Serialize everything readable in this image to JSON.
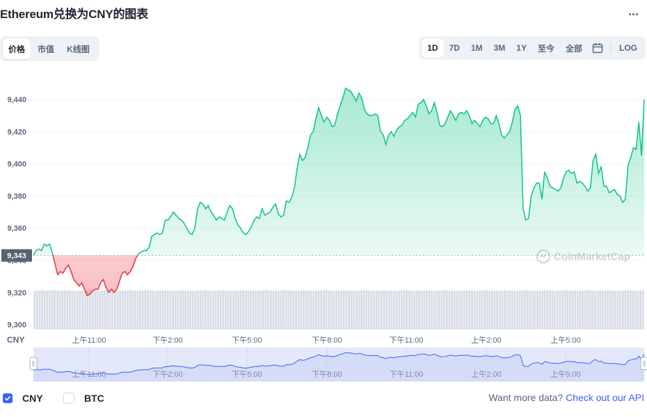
{
  "header": {
    "title": "Ethereum兑换为CNY的图表",
    "more_label": "..."
  },
  "tabs": [
    {
      "label": "价格",
      "active": true
    },
    {
      "label": "市值",
      "active": false
    },
    {
      "label": "K线图",
      "active": false
    }
  ],
  "ranges": [
    {
      "label": "1D",
      "active": true
    },
    {
      "label": "7D",
      "active": false
    },
    {
      "label": "1M",
      "active": false
    },
    {
      "label": "3M",
      "active": false
    },
    {
      "label": "1Y",
      "active": false
    },
    {
      "label": "至今",
      "active": false
    },
    {
      "label": "全部",
      "active": false
    }
  ],
  "log_label": "LOG",
  "colors": {
    "up": "#16c784",
    "down": "#ea3943",
    "accent": "#3861fb",
    "grid": "#eff2f5",
    "text_muted": "#58667e"
  },
  "chart_data": {
    "type": "line",
    "currency": "CNY",
    "baseline": 9343,
    "current_price_label": "9,343",
    "ylim": [
      9297,
      9453
    ],
    "yticks": [
      9300,
      9320,
      9340,
      9360,
      9380,
      9400,
      9420,
      9440
    ],
    "ytick_labels": [
      "9,300",
      "9,320",
      "9,340",
      "9,360",
      "9,380",
      "9,400",
      "9,420",
      "9,440"
    ],
    "xtick_labels": [
      "上午11:00",
      "下午2:00",
      "下午5:00",
      "下午8:00",
      "下午11:00",
      "上午2:00",
      "上午5:00"
    ],
    "watermark": "CoinMarketCap",
    "series": [
      {
        "values": [
          9343,
          9346,
          9347,
          9346,
          9350,
          9349,
          9350,
          9345,
          9338,
          9331,
          9333,
          9332,
          9335,
          9337,
          9333,
          9328,
          9326,
          9324,
          9326,
          9322,
          9318,
          9319,
          9321,
          9322,
          9322,
          9326,
          9328,
          9323,
          9320,
          9322,
          9320,
          9322,
          9327,
          9332,
          9333,
          9331,
          9333,
          9336,
          9341,
          9344,
          9345,
          9346,
          9346,
          9348,
          9355,
          9356,
          9357,
          9356,
          9357,
          9365,
          9365,
          9367,
          9370,
          9368,
          9366,
          9365,
          9363,
          9360,
          9357,
          9356,
          9360,
          9372,
          9376,
          9375,
          9372,
          9374,
          9370,
          9368,
          9365,
          9367,
          9366,
          9365,
          9370,
          9374,
          9372,
          9366,
          9362,
          9360,
          9357,
          9356,
          9358,
          9361,
          9365,
          9367,
          9366,
          9372,
          9368,
          9369,
          9370,
          9373,
          9375,
          9369,
          9367,
          9368,
          9377,
          9376,
          9379,
          9385,
          9397,
          9406,
          9402,
          9404,
          9410,
          9418,
          9420,
          9428,
          9435,
          9430,
          9426,
          9429,
          9427,
          9423,
          9424,
          9431,
          9436,
          9441,
          9447,
          9446,
          9445,
          9442,
          9439,
          9444,
          9441,
          9434,
          9431,
          9430,
          9430,
          9431,
          9430,
          9420,
          9418,
          9412,
          9418,
          9420,
          9417,
          9421,
          9423,
          9424,
          9427,
          9428,
          9430,
          9432,
          9429,
          9437,
          9438,
          9440,
          9436,
          9431,
          9433,
          9438,
          9432,
          9424,
          9423,
          9425,
          9429,
          9433,
          9430,
          9427,
          9431,
          9432,
          9431,
          9433,
          9430,
          9425,
          9427,
          9425,
          9423,
          9427,
          9429,
          9428,
          9425,
          9425,
          9430,
          9425,
          9418,
          9416,
          9418,
          9420,
          9426,
          9434,
          9436,
          9430,
          9372,
          9365,
          9366,
          9380,
          9385,
          9388,
          9388,
          9378,
          9395,
          9391,
          9386,
          9385,
          9384,
          9383,
          9385,
          9391,
          9395,
          9396,
          9394,
          9395,
          9388,
          9389,
          9388,
          9386,
          9383,
          9385,
          9402,
          9406,
          9394,
          9398,
          9386,
          9386,
          9382,
          9383,
          9384,
          9381,
          9380,
          9376,
          9378,
          9399,
          9404,
          9410,
          9409,
          9426,
          9405,
          9440
        ]
      }
    ],
    "volume_values": [
      0.79,
      0.8,
      0.8,
      0.81,
      0.79,
      0.8,
      0.8,
      0.8,
      0.81,
      0.8,
      0.79,
      0.81,
      0.8,
      0.8,
      0.8,
      0.8,
      0.79,
      0.8,
      0.8,
      0.81,
      0.79,
      0.8,
      0.81,
      0.8,
      0.8,
      0.8,
      0.79,
      0.8,
      0.8,
      0.8,
      0.8,
      0.81,
      0.8,
      0.79,
      0.8,
      0.8,
      0.8,
      0.8,
      0.81,
      0.8,
      0.8,
      0.79,
      0.8,
      0.8,
      0.81,
      0.8,
      0.8,
      0.8,
      0.79,
      0.8,
      0.8,
      0.8,
      0.81,
      0.8,
      0.8,
      0.8,
      0.79,
      0.8,
      0.8,
      0.81,
      0.8,
      0.8,
      0.8,
      0.79,
      0.8,
      0.8,
      0.8,
      0.8,
      0.81,
      0.8,
      0.8,
      0.79,
      0.8,
      0.8,
      0.8,
      0.81,
      0.8,
      0.8,
      0.8,
      0.79,
      0.8,
      0.8,
      0.8,
      0.81,
      0.8,
      0.8,
      0.8,
      0.8,
      0.79,
      0.8,
      0.8,
      0.8,
      0.81,
      0.8,
      0.8,
      0.79,
      0.8,
      0.8,
      0.8,
      0.81,
      0.8,
      0.8,
      0.8,
      0.8,
      0.79,
      0.8,
      0.8,
      0.81,
      0.8,
      0.8,
      0.8,
      0.79,
      0.8,
      0.8,
      0.8,
      0.8,
      0.81,
      0.8,
      0.8,
      0.79,
      0.8,
      0.8,
      0.8,
      0.81,
      0.8,
      0.8,
      0.8,
      0.8,
      0.79,
      0.8,
      0.8,
      0.8,
      0.81,
      0.8,
      0.8,
      0.79,
      0.8,
      0.8,
      0.8,
      0.81,
      0.8,
      0.8,
      0.8,
      0.8,
      0.79,
      0.8,
      0.8,
      0.8,
      0.81,
      0.8,
      0.8,
      0.79,
      0.8,
      0.8,
      0.8,
      0.8,
      0.81,
      0.8,
      0.8,
      0.79,
      0.8,
      0.8,
      0.8,
      0.81,
      0.8,
      0.8,
      0.8,
      0.8,
      0.79,
      0.8,
      0.8,
      0.8,
      0.81,
      0.8,
      0.8,
      0.79,
      0.8,
      0.8,
      0.8,
      0.8,
      0.81,
      0.8,
      0.8,
      0.79,
      0.8,
      0.8,
      0.8,
      0.81,
      0.8,
      0.8,
      0.8,
      0.8,
      0.79,
      0.8,
      0.8,
      0.8,
      0.81,
      0.8,
      0.8,
      0.79,
      0.8,
      0.8,
      0.8,
      0.8,
      0.81,
      0.8,
      0.8,
      0.79,
      0.8,
      0.8,
      0.8,
      0.81,
      0.8,
      0.8,
      0.8,
      0.8,
      0.79,
      0.8,
      0.8,
      0.8,
      0.81,
      0.8,
      0.8,
      0.79,
      0.8,
      0.8,
      0.8,
      0.8,
      0.81,
      0.8,
      0.8,
      0.79,
      0.8,
      0.8,
      0.8,
      0.81,
      0.8,
      0.8,
      0.8,
      0.8,
      0.79,
      0.8,
      0.8
    ]
  },
  "legend": [
    {
      "label": "CNY",
      "checked": true
    },
    {
      "label": "BTC",
      "checked": false
    }
  ],
  "footer": {
    "text": "Want more data?",
    "link_label": "Check out our API"
  }
}
